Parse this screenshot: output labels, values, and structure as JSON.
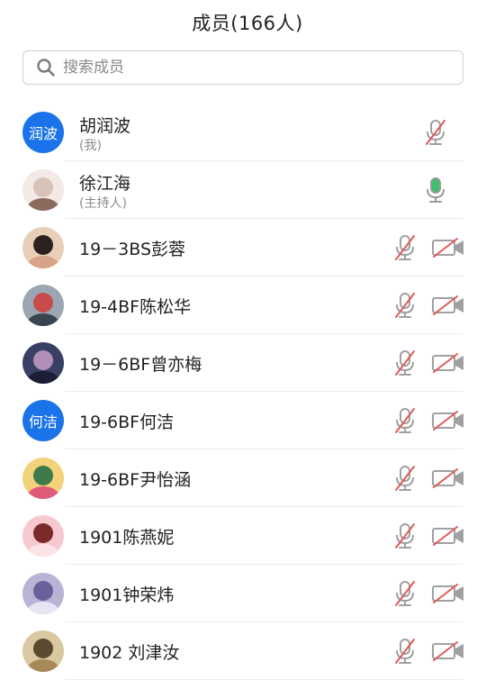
{
  "header": {
    "title": "成员(166人)"
  },
  "search": {
    "placeholder": "搜索成员",
    "icon": "search-icon"
  },
  "colors": {
    "avatar_bg": "#1a73e8",
    "muted_red": "#e05a5a",
    "mic_green": "#3cc06e",
    "icon_gray": "#a0a0a0"
  },
  "members": [
    {
      "name": "胡润波",
      "sub": "(我)",
      "avatar_text": "润波",
      "mic": "muted",
      "cam": "none"
    },
    {
      "name": "徐江海",
      "sub": "(主持人)",
      "avatar_text": "",
      "mic": "active",
      "cam": "none"
    },
    {
      "name": "19－3BS彭蓉",
      "sub": "",
      "avatar_text": "",
      "mic": "muted",
      "cam": "off"
    },
    {
      "name": "19-4BF陈松华",
      "sub": "",
      "avatar_text": "",
      "mic": "muted",
      "cam": "off"
    },
    {
      "name": "19－6BF曾亦梅",
      "sub": "",
      "avatar_text": "",
      "mic": "muted",
      "cam": "off"
    },
    {
      "name": "19-6BF何洁",
      "sub": "",
      "avatar_text": "何洁",
      "mic": "muted",
      "cam": "off"
    },
    {
      "name": "19-6BF尹怡涵",
      "sub": "",
      "avatar_text": "",
      "mic": "muted",
      "cam": "off"
    },
    {
      "name": "1901陈燕妮",
      "sub": "",
      "avatar_text": "",
      "mic": "muted",
      "cam": "off"
    },
    {
      "name": "1901钟荣炜",
      "sub": "",
      "avatar_text": "",
      "mic": "muted",
      "cam": "off"
    },
    {
      "name": "1902 刘津汝",
      "sub": "",
      "avatar_text": "",
      "mic": "muted",
      "cam": "off"
    }
  ]
}
